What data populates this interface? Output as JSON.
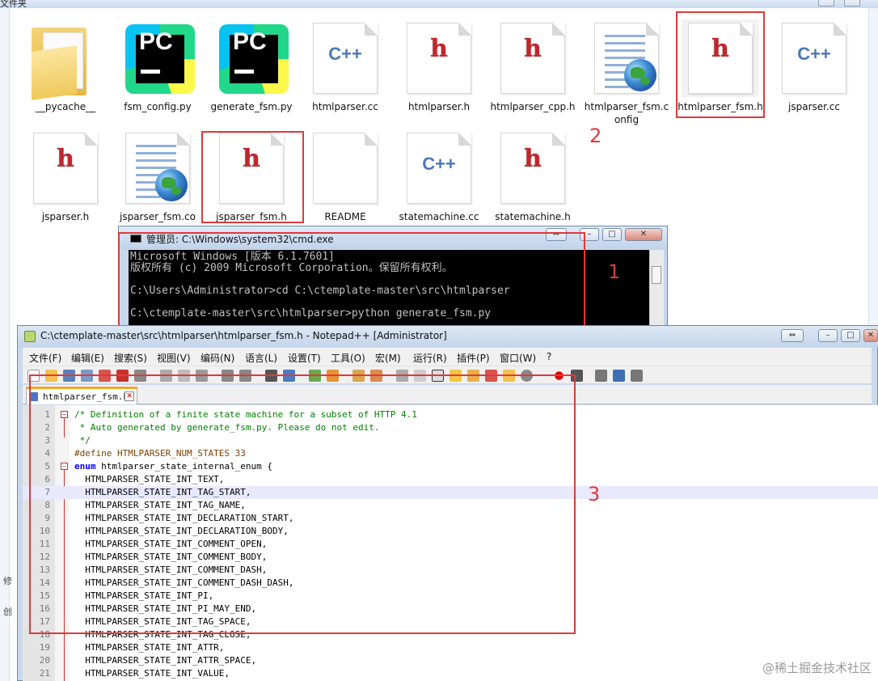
{
  "explorer": {
    "title_fragment": "文件夹",
    "left_fragments": [
      "修",
      "创"
    ],
    "files_row1": [
      {
        "name": "__pycache__",
        "icon": "folder-icon"
      },
      {
        "name": "fsm_config.py",
        "icon": "pycharm-icon"
      },
      {
        "name": "generate_fsm.py",
        "icon": "pycharm-icon"
      },
      {
        "name": "htmlparser.cc",
        "icon": "cpp-file-icon"
      },
      {
        "name": "htmlparser.h",
        "icon": "header-file-icon"
      },
      {
        "name": "htmlparser_cpp.h",
        "icon": "header-file-icon"
      },
      {
        "name": "htmlparser_fsm.config",
        "icon": "config-file-icon"
      },
      {
        "name": "htmlparser_fsm.h",
        "icon": "header-file-icon"
      },
      {
        "name": "jsparser.cc",
        "icon": "cpp-file-icon"
      }
    ],
    "files_row2": [
      {
        "name": "jsparser.h",
        "icon": "header-file-icon"
      },
      {
        "name": "jsparser_fsm.co",
        "icon": "config-file-icon"
      },
      {
        "name": "jsparser_fsm.h",
        "icon": "header-file-icon"
      },
      {
        "name": "README",
        "icon": "blank-file-icon"
      },
      {
        "name": "statemachine.cc",
        "icon": "cpp-file-icon"
      },
      {
        "name": "statemachine.h",
        "icon": "header-file-icon"
      }
    ]
  },
  "annotations": {
    "one": "1",
    "two": "2",
    "three": "3"
  },
  "cmd": {
    "title": "管理员: C:\\Windows\\system32\\cmd.exe",
    "lines": [
      "Microsoft Windows [版本 6.1.7601]",
      "版权所有 (c) 2009 Microsoft Corporation。保留所有权利。",
      "",
      "C:\\Users\\Administrator>cd C:\\ctemplate-master\\src\\htmlparser",
      "",
      "C:\\ctemplate-master\\src\\htmlparser>python generate_fsm.py"
    ]
  },
  "npp": {
    "title": "C:\\ctemplate-master\\src\\htmlparser\\htmlparser_fsm.h - Notepad++ [Administrator]",
    "menu": [
      "文件(F)",
      "编辑(E)",
      "搜索(S)",
      "视图(V)",
      "编码(N)",
      "语言(L)",
      "设置(T)",
      "工具(O)",
      "宏(M)",
      "运行(R)",
      "插件(P)",
      "窗口(W)",
      "?"
    ],
    "tab": "htmlparser_fsm.h",
    "code": [
      {
        "n": "1",
        "t": "/* Definition of a finite state machine for a subset of HTTP 4.1",
        "cls": "comment"
      },
      {
        "n": "2",
        "t": " * Auto generated by generate_fsm.py. Please do not edit.",
        "cls": "comment"
      },
      {
        "n": "3",
        "t": " */",
        "cls": "comment"
      },
      {
        "n": "4",
        "t": "#define HTMLPARSER_NUM_STATES 33",
        "cls": "pre"
      },
      {
        "n": "5",
        "t": "enum htmlparser_state_internal_enum {",
        "cls": "enum"
      },
      {
        "n": "6",
        "t": "  HTMLPARSER_STATE_INT_TEXT,",
        "cls": ""
      },
      {
        "n": "7",
        "t": "  HTMLPARSER_STATE_INT_TAG_START,",
        "cls": ""
      },
      {
        "n": "8",
        "t": "  HTMLPARSER_STATE_INT_TAG_NAME,",
        "cls": ""
      },
      {
        "n": "9",
        "t": "  HTMLPARSER_STATE_INT_DECLARATION_START,",
        "cls": ""
      },
      {
        "n": "10",
        "t": "  HTMLPARSER_STATE_INT_DECLARATION_BODY,",
        "cls": ""
      },
      {
        "n": "11",
        "t": "  HTMLPARSER_STATE_INT_COMMENT_OPEN,",
        "cls": ""
      },
      {
        "n": "12",
        "t": "  HTMLPARSER_STATE_INT_COMMENT_BODY,",
        "cls": ""
      },
      {
        "n": "13",
        "t": "  HTMLPARSER_STATE_INT_COMMENT_DASH,",
        "cls": ""
      },
      {
        "n": "14",
        "t": "  HTMLPARSER_STATE_INT_COMMENT_DASH_DASH,",
        "cls": ""
      },
      {
        "n": "15",
        "t": "  HTMLPARSER_STATE_INT_PI,",
        "cls": ""
      },
      {
        "n": "16",
        "t": "  HTMLPARSER_STATE_INT_PI_MAY_END,",
        "cls": ""
      },
      {
        "n": "17",
        "t": "  HTMLPARSER_STATE_INT_TAG_SPACE,",
        "cls": ""
      },
      {
        "n": "18",
        "t": "  HTMLPARSER_STATE_INT_TAG_CLOSE,",
        "cls": ""
      },
      {
        "n": "19",
        "t": "  HTMLPARSER_STATE_INT_ATTR,",
        "cls": ""
      },
      {
        "n": "20",
        "t": "  HTMLPARSER_STATE_INT_ATTR_SPACE,",
        "cls": ""
      },
      {
        "n": "21",
        "t": "  HTMLPARSER_STATE_INT_VALUE,",
        "cls": ""
      }
    ]
  },
  "watermark": "@稀土掘金技术社区",
  "colors": {
    "annotation_red": "#e0393b",
    "comment_green": "#008000",
    "keyword_blue": "#0000ff",
    "tab_accent": "#f5a623"
  }
}
